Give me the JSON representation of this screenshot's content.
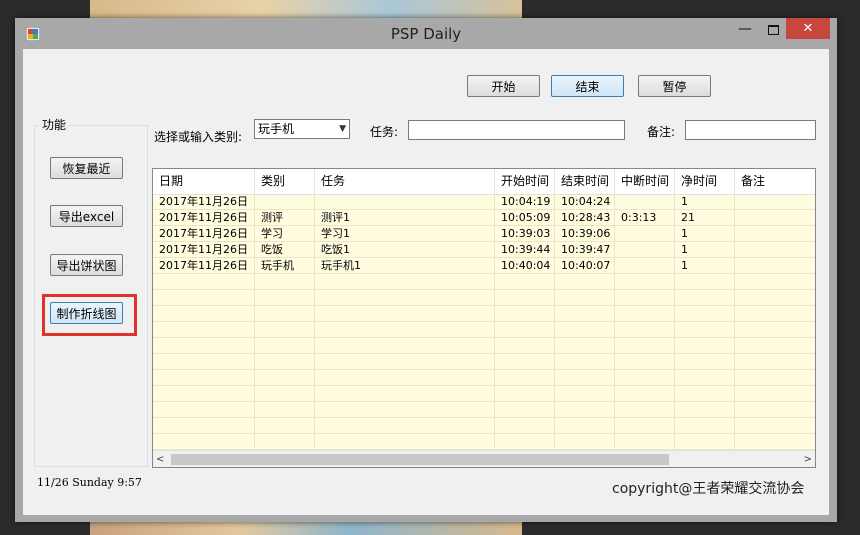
{
  "window": {
    "title": "PSP Daily",
    "minimize": "—",
    "close": "✕"
  },
  "toolbar": {
    "start_label": "开始",
    "end_label": "结束",
    "pause_label": "暂停"
  },
  "function_group": {
    "title": "功能",
    "restore_label": "恢复最近",
    "export_excel_label": "导出excel",
    "export_pie_label": "导出饼状图",
    "make_line_label": "制作折线图"
  },
  "form": {
    "category_label": "选择或输入类别:",
    "category_value": "玩手机",
    "task_label": "任务:",
    "task_value": "",
    "note_label": "备注:",
    "note_value": ""
  },
  "table": {
    "columns": [
      "日期",
      "类别",
      "任务",
      "开始时间",
      "结束时间",
      "中断时间",
      "净时间",
      "备注"
    ],
    "rows": [
      [
        "2017年11月26日",
        "",
        "",
        "10:04:19",
        "10:04:24",
        "",
        "1",
        ""
      ],
      [
        "2017年11月26日",
        "测评",
        "测评1",
        "10:05:09",
        "10:28:43",
        "0:3:13",
        "21",
        ""
      ],
      [
        "2017年11月26日",
        "学习",
        "学习1",
        "10:39:03",
        "10:39:06",
        "",
        "1",
        ""
      ],
      [
        "2017年11月26日",
        "吃饭",
        "吃饭1",
        "10:39:44",
        "10:39:47",
        "",
        "1",
        ""
      ],
      [
        "2017年11月26日",
        "玩手机",
        "玩手机1",
        "10:40:04",
        "10:40:07",
        "",
        "1",
        ""
      ]
    ],
    "scroll_left": "<",
    "scroll_right": ">"
  },
  "status": {
    "datetime": "11/26  Sunday 9:57"
  },
  "footer": {
    "copyright": "copyright@王者荣耀交流协会"
  },
  "colors": {
    "grid_background": "#fffce0",
    "close_button": "#c7463f",
    "highlight_box": "#e0322c"
  }
}
